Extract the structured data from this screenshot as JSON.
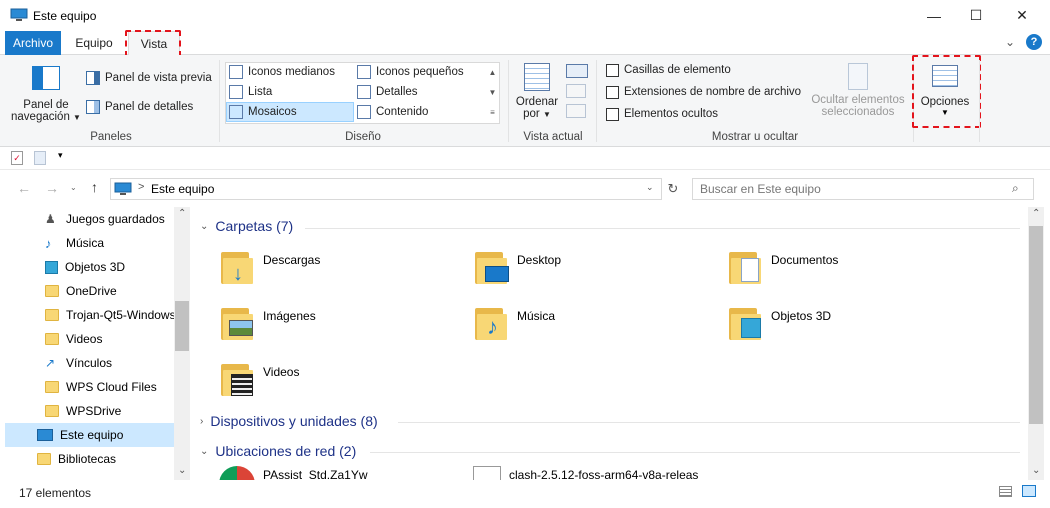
{
  "window": {
    "title": "Este equipo",
    "minimize": "—",
    "maximize": "☐",
    "close": "✕"
  },
  "tabs": {
    "archivo": "Archivo",
    "equipo": "Equipo",
    "vista": "Vista"
  },
  "ribbon": {
    "paneles": {
      "label": "Paneles",
      "panel_navegacion": "Panel de",
      "panel_navegacion_2": "navegación",
      "vista_previa": "Panel de vista previa",
      "detalles": "Panel de detalles"
    },
    "diseno": {
      "label": "Diseño",
      "options": [
        "Iconos medianos",
        "Iconos pequeños",
        "Lista",
        "Detalles",
        "Mosaicos",
        "Contenido"
      ],
      "selected": "Mosaicos"
    },
    "vista_actual": {
      "label": "Vista actual",
      "ordenar": "Ordenar",
      "por": "por"
    },
    "mostrar": {
      "label": "Mostrar u ocultar",
      "casillas": "Casillas de elemento",
      "extensiones": "Extensiones de nombre de archivo",
      "ocultos": "Elementos ocultos",
      "ocultar_sel": "Ocultar elementos",
      "ocultar_sel_2": "seleccionados"
    },
    "opciones": "Opciones"
  },
  "address": {
    "path": "Este equipo",
    "separator": ">",
    "search_placeholder": "Buscar en Este equipo"
  },
  "sidebar": {
    "items": [
      "Juegos guardados",
      "Música",
      "Objetos 3D",
      "OneDrive",
      "Trojan-Qt5-Windows",
      "Videos",
      "Vínculos",
      "WPS Cloud Files",
      "WPSDrive",
      "Este equipo",
      "Bibliotecas"
    ],
    "selected": "Este equipo"
  },
  "main": {
    "carpetas_header": "Carpetas (7)",
    "folders": [
      "Descargas",
      "Desktop",
      "Documentos",
      "Imágenes",
      "Música",
      "Objetos 3D",
      "Videos"
    ],
    "dispositivos_header": "Dispositivos y unidades (8)",
    "red_header": "Ubicaciones de red (2)",
    "network": [
      "PAssist_Std.Za1Yw",
      "clash-2.5.12-foss-arm64-v8a-releas"
    ]
  },
  "status": {
    "count": "17 elementos"
  },
  "colors": {
    "accent": "#1979ca",
    "selection": "#cce8ff",
    "highlight_dash": "#e3141c",
    "header_text": "#1e3287"
  }
}
